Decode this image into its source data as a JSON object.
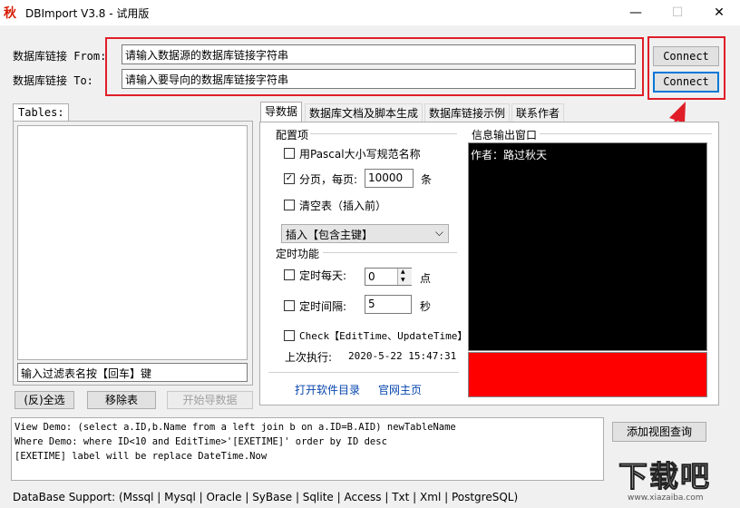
{
  "app": {
    "icon_glyph": "秋",
    "title": "DBImport V3.8 - 试用版"
  },
  "window_controls": {
    "minimize": "—",
    "maximize": "☐",
    "close": "✕"
  },
  "connection": {
    "from_label": "数据库链接 From:",
    "from_value": "请输入数据源的数据库链接字符串",
    "to_label": "数据库链接 To:",
    "to_value": "请输入要导向的数据库链接字符串",
    "connect_from_label": "Connect",
    "connect_to_label": "Connect"
  },
  "tables": {
    "title": "Tables:",
    "filter_value": "输入过滤表名按【回车】键",
    "select_all_label": "(反)全选",
    "remove_label": "移除表",
    "start_label": "开始导数据"
  },
  "tabs": [
    {
      "label": "导数据"
    },
    {
      "label": "数据库文档及脚本生成"
    },
    {
      "label": "数据库链接示例"
    },
    {
      "label": "联系作者"
    }
  ],
  "config": {
    "title": "配置项",
    "pascal_label": "用Pascal大小写规范名称",
    "pascal_checked": "",
    "paging_label": "分页，每页:",
    "paging_checked": "✓",
    "paging_value": "10000",
    "paging_unit": "条",
    "clear_label": "清空表（插入前）",
    "clear_checked": "",
    "mode_value": "插入【包含主键】",
    "dropdown_arrow": "⌵"
  },
  "timer": {
    "title": "定时功能",
    "daily_label": "定时每天:",
    "daily_value": "0",
    "daily_unit": "点",
    "spin_up": "▲",
    "spin_down": "▼",
    "interval_label": "定时间隔:",
    "interval_value": "5",
    "interval_unit": "秒",
    "check_label": "Check【EditTime、UpdateTime】",
    "last_exec_label": "上次执行:",
    "last_exec_value": "2020-5-22 15:47:31"
  },
  "links": {
    "open_dir": "打开软件目录",
    "homepage": "官网主页"
  },
  "output": {
    "title": "信息输出窗口",
    "text": "作者：路过秋天"
  },
  "demo_lines": [
    "View  Demo: (select a.ID,b.Name from a left join b on a.ID=B.AID) newTableName",
    "Where Demo: where ID<10 and EditTime>'[EXETIME]' order by ID desc",
    "[EXETIME] label will be replace DateTime.Now"
  ],
  "add_view_label": "添加视图查询",
  "status": {
    "text": "DataBase Support:   (Mssql | Mysql | Oracle | SyBase | Sqlite | Access | Txt | Xml | PostgreSQL)"
  },
  "watermark": {
    "brand": "下载吧",
    "url": "www.xiazaiba.com"
  },
  "colors": {
    "annotation_red": "#e01e28",
    "output_bg": "#000000",
    "progress_red": "#ff0000",
    "link_blue": "#0645ad",
    "focus_blue": "#0078d7"
  }
}
